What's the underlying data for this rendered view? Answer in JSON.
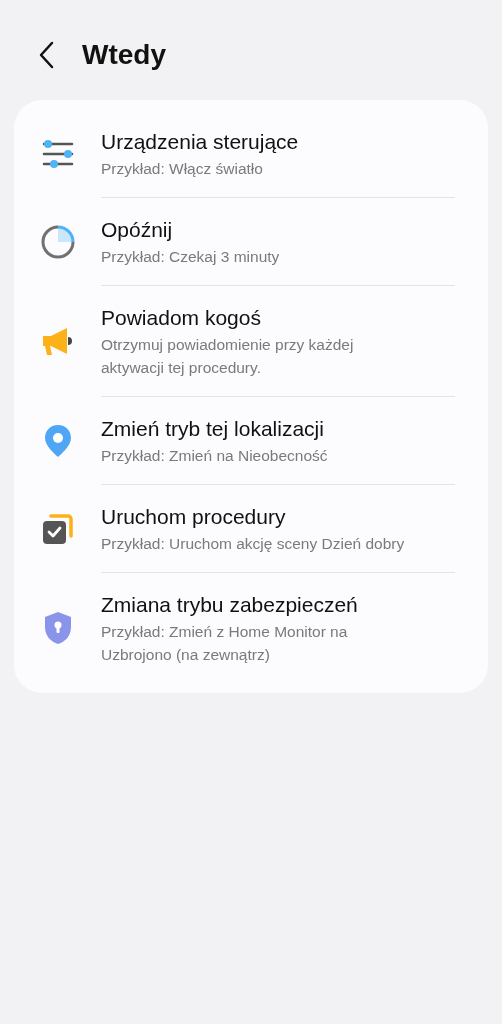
{
  "header": {
    "title": "Wtedy"
  },
  "items": [
    {
      "kind": "sliders",
      "title": "Urządzenia sterujące",
      "subtitle": "Przykład: Włącz światło"
    },
    {
      "kind": "timer",
      "title": "Opóźnij",
      "subtitle": "Przykład: Czekaj 3 minuty"
    },
    {
      "kind": "megaphone",
      "title": "Powiadom kogoś",
      "subtitle": "Otrzymuj powiadomienie przy każdej aktywacji tej procedury."
    },
    {
      "kind": "pin",
      "title": "Zmień tryb tej lokalizacji",
      "subtitle": "Przykład: Zmień na Nieobecność"
    },
    {
      "kind": "routine",
      "title": "Uruchom procedury",
      "subtitle": "Przykład: Uruchom akcję sceny Dzień dobry"
    },
    {
      "kind": "shield",
      "title": "Zmiana trybu zabezpieczeń",
      "subtitle": "Przykład: Zmień z Home Monitor na Uzbrojono (na zewnątrz)"
    }
  ]
}
